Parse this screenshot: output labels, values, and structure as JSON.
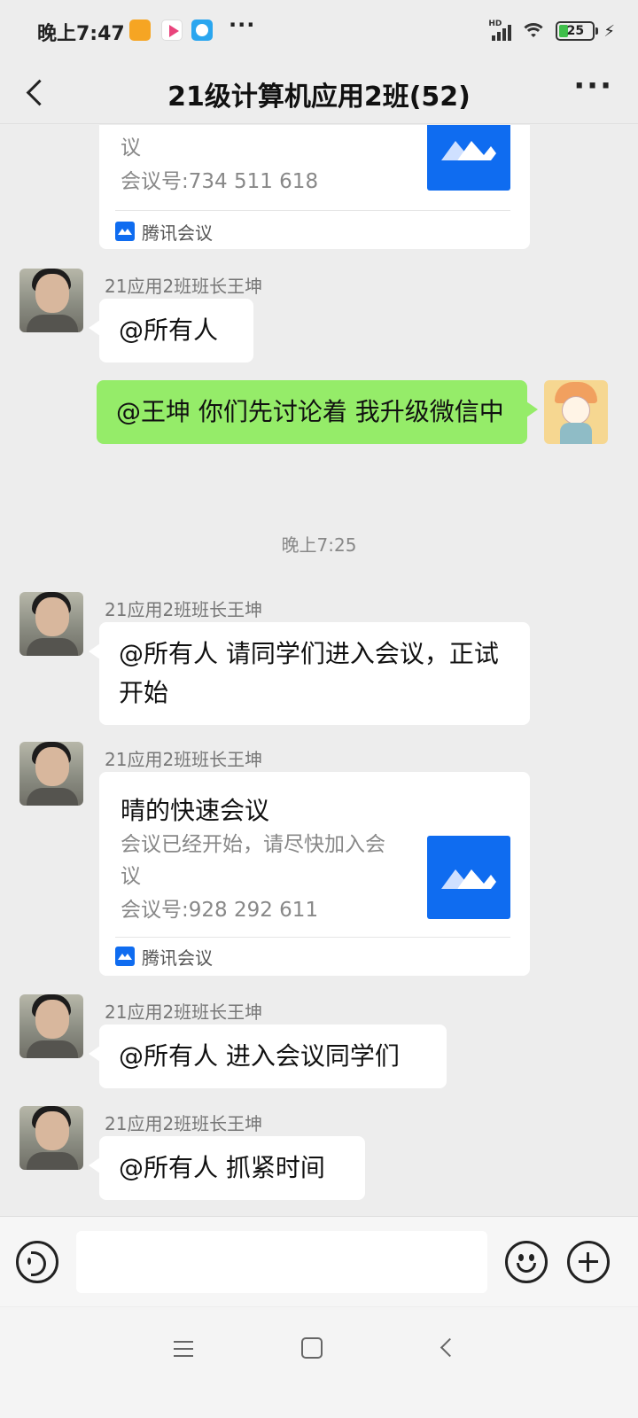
{
  "status_bar": {
    "time": "晚上7:47",
    "more": "···",
    "network": "HD",
    "battery": "25"
  },
  "header": {
    "title": "21级计算机应用2班(52)",
    "more": "···"
  },
  "messages": {
    "m0": {
      "desc": "会议已经开始，请尽快加入会议",
      "meeting_id": "会议号:734 511 618",
      "source": "腾讯会议"
    },
    "m1": {
      "sender": "21应用2班班长王坤",
      "text": "@所有人"
    },
    "m2": {
      "text": "@王坤  你们先讨论着  我升级微信中"
    },
    "time1": "晚上7:25",
    "m3": {
      "sender": "21应用2班班长王坤",
      "text": "@所有人  请同学们进入会议，正试开始"
    },
    "m4": {
      "sender": "21应用2班班长王坤",
      "title": "晴的快速会议",
      "desc": "会议已经开始，请尽快加入会议",
      "meeting_id": "会议号:928 292 611",
      "source": "腾讯会议"
    },
    "m5": {
      "sender": "21应用2班班长王坤",
      "text": "@所有人  进入会议同学们"
    },
    "m6": {
      "sender": "21应用2班班长王坤",
      "text": "@所有人  抓紧时间"
    }
  },
  "input": {
    "value": "",
    "placeholder": ""
  },
  "colors": {
    "self_bubble": "#95ec69",
    "app_blue": "#0f6cf0",
    "background": "#ededed"
  },
  "icons": [
    "voice-icon",
    "emoji-icon",
    "plus-icon",
    "back-icon",
    "more-icon",
    "tencent-meeting-icon"
  ]
}
